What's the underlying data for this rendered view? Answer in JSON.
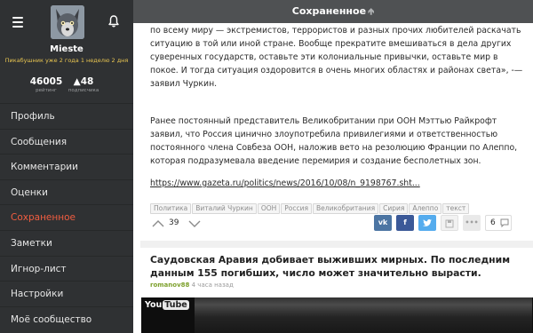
{
  "sidebar": {
    "username": "Mieste",
    "user_subtitle": "Пикабушник уже 2 года 1 неделю 2 дня",
    "rating_value": "46005",
    "rating_label": "рейтинг",
    "subscribers_value": "48",
    "subscribers_label": "подписчика",
    "menu": [
      {
        "label": "Профиль"
      },
      {
        "label": "Сообщения"
      },
      {
        "label": "Комментарии"
      },
      {
        "label": "Оценки"
      },
      {
        "label": "Сохраненное"
      },
      {
        "label": "Заметки"
      },
      {
        "label": "Игнор-лист"
      },
      {
        "label": "Настройки"
      },
      {
        "label": "Моё сообщество"
      }
    ],
    "active_item": "Сохраненное"
  },
  "header": {
    "title": "Сохраненное"
  },
  "post": {
    "paragraph1": "по всему миру — экстремистов, террористов и разных прочих любителей раскачать ситуацию в той или иной стране. Вообще прекратите вмешиваться в дела других суверенных государств, оставьте эти колониальные привычки, оставьте мир в покое. И тогда ситуация оздоровится в очень многих областях и районах света», -— заявил Чуркин.",
    "paragraph2": "Ранее постоянный представитель Великобритании при ООН Мэттью Райкрофт заявил, что Россия цинично злоупотребила привилегиями и ответственностью постоянного члена Совбеза ООН, наложив вето на резолюцию Франции по Алеппо, которая подразумевала введение перемирия и создание бесполетных зон.",
    "link": "https://www.gazeta.ru/politics/news/2016/10/08/n_9198767.sht...",
    "tags": [
      "Политика",
      "Виталий Чуркин",
      "ООН",
      "Россия",
      "Великобритания",
      "Сирия",
      "Алеппо",
      "текст"
    ],
    "vote_count": "39",
    "comment_count": "6",
    "share": {
      "vk": "vk",
      "fb": "f"
    }
  },
  "post2": {
    "title": "Саудовская Аравия добивает выживших мирных. По последним данным 155 погибших, число может значительно вырасти.",
    "author": "romanov88",
    "time": "4 часа назад",
    "video_logo_you": "You",
    "video_logo_tube": "Tube"
  },
  "colors": {
    "sidebar_bg": "#2f3133",
    "header_bg": "#4f5153",
    "active_menu": "#f15d40",
    "author": "#7da02c",
    "subtitle": "#e7c451"
  }
}
